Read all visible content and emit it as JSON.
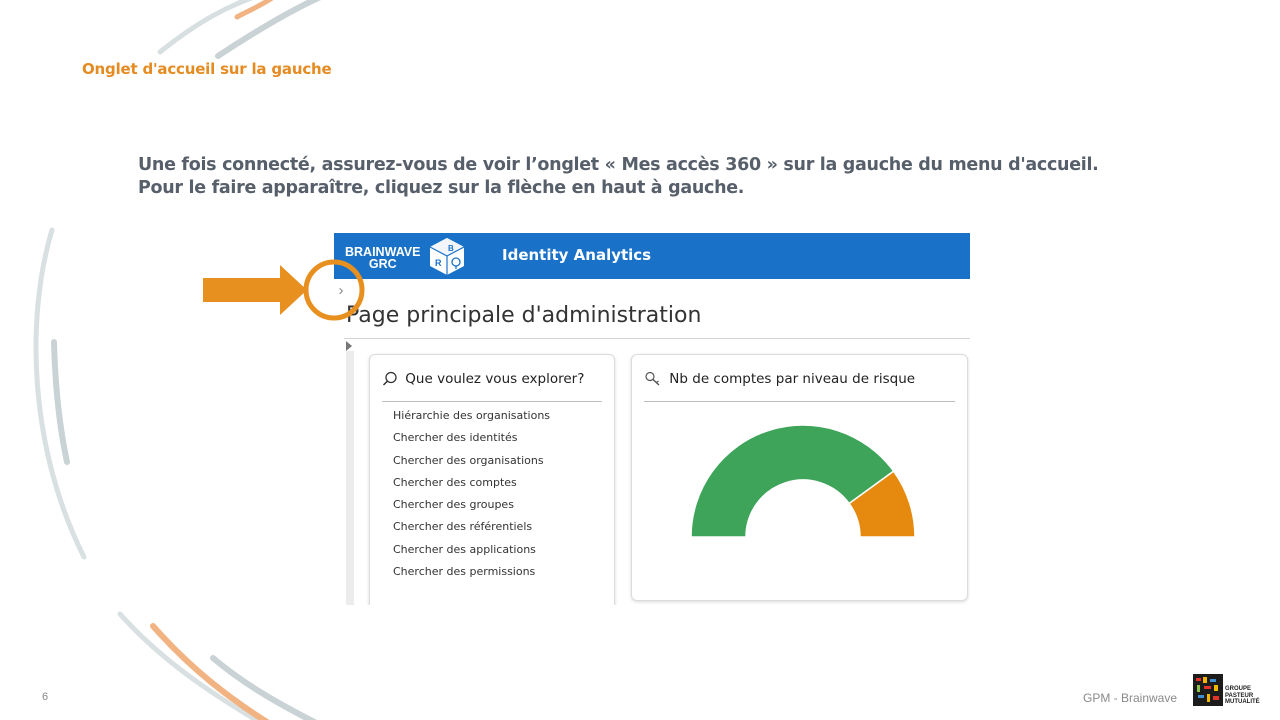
{
  "slide": {
    "heading": "Onglet d'accueil sur la gauche",
    "instruction_line1": "Une fois connecté, assurez-vous de voir l’onglet « Mes accès 360 » sur la gauche du menu d'accueil.",
    "instruction_line2": "Pour le faire apparaître, cliquez sur la flèche en haut à gauche.",
    "page_number": "6",
    "footer_text": "GPM - Brainwave",
    "logo_text_1": "GROUPE",
    "logo_text_2": "PASTEUR",
    "logo_text_3": "MUTUALITÉ"
  },
  "app": {
    "brand_line1": "BRAINWAVE",
    "brand_line2": "GRC",
    "cube_letters": [
      "B",
      "R"
    ],
    "title": "Identity Analytics",
    "expand_glyph": "›",
    "page_title": "Page principale d'administration",
    "colors": {
      "topbar": "#1a72c8",
      "accent": "#e58b22"
    }
  },
  "explore": {
    "title": "Que voulez vous explorer?",
    "icon": "search-icon",
    "items": [
      "Hiérarchie des organisations",
      "Chercher des identités",
      "Chercher des organisations",
      "Chercher des comptes",
      "Chercher des groupes",
      "Chercher des référentiels",
      "Chercher des applications",
      "Chercher des permissions"
    ]
  },
  "risk": {
    "title": "Nb de comptes par niveau de risque",
    "icon": "key-search-icon"
  },
  "chart_data": {
    "type": "pie",
    "variant": "half-donut",
    "values": [
      80,
      20
    ],
    "colors": [
      "#3ea45a",
      "#e58a0f"
    ]
  }
}
